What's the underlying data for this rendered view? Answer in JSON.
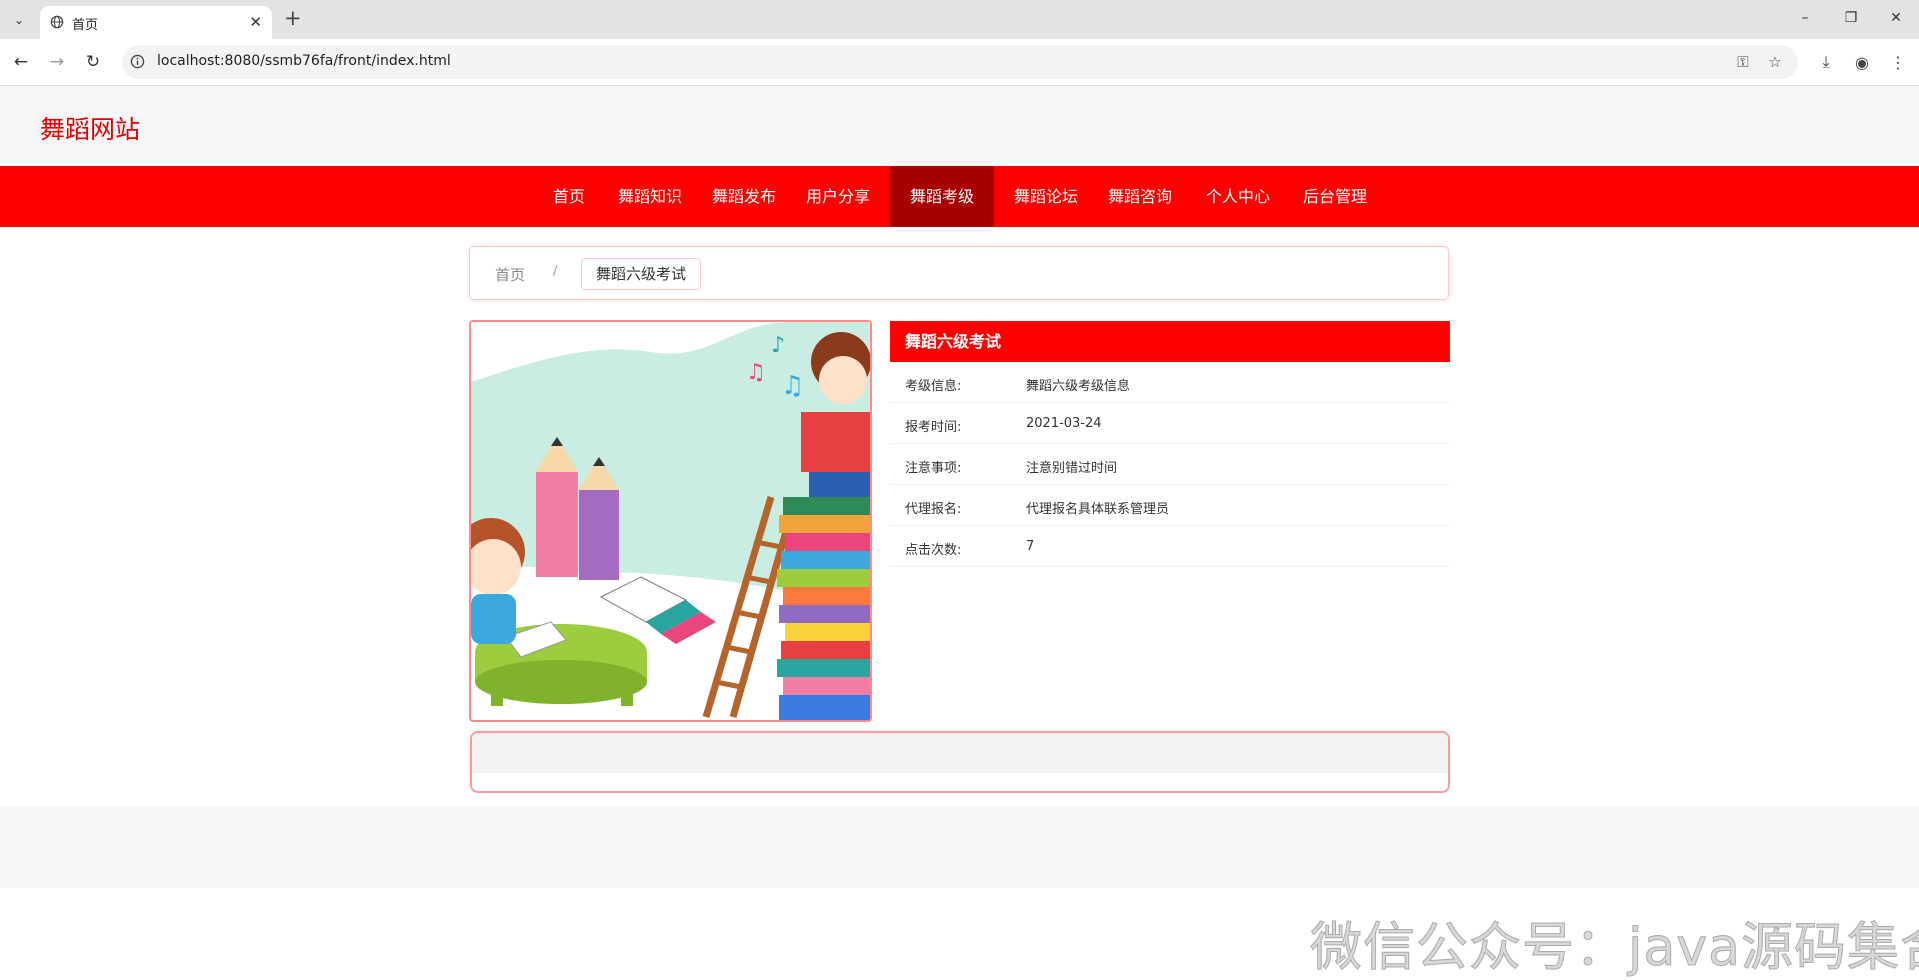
{
  "browser": {
    "tab_title": "首页",
    "url": "localhost:8080/ssmb76fa/front/index.html"
  },
  "site": {
    "logo": "舞蹈网站",
    "nav": [
      {
        "label": "首页",
        "active": false
      },
      {
        "label": "舞蹈知识",
        "active": false
      },
      {
        "label": "舞蹈发布",
        "active": false
      },
      {
        "label": "用户分享",
        "active": false
      },
      {
        "label": "舞蹈考级",
        "active": true
      },
      {
        "label": "舞蹈论坛",
        "active": false
      },
      {
        "label": "舞蹈咨询",
        "active": false
      },
      {
        "label": "个人中心",
        "active": false
      },
      {
        "label": "后台管理",
        "active": false
      }
    ]
  },
  "breadcrumb": {
    "home": "首页",
    "separator": "/",
    "current": "舞蹈六级考试"
  },
  "detail": {
    "title": "舞蹈六级考试",
    "rows": [
      {
        "label": "考级信息:",
        "value": "舞蹈六级考级信息"
      },
      {
        "label": "报考时间:",
        "value": "2021-03-24"
      },
      {
        "label": "注意事项:",
        "value": "注意别错过时间"
      },
      {
        "label": "代理报名:",
        "value": "代理报名具体联系管理员"
      },
      {
        "label": "点击次数:",
        "value": "7"
      }
    ]
  },
  "watermark": "微信公众号：java源码集合",
  "colors": {
    "brand_red": "#ff0000",
    "nav_active": "#a80000",
    "logo_red": "#e60000"
  }
}
